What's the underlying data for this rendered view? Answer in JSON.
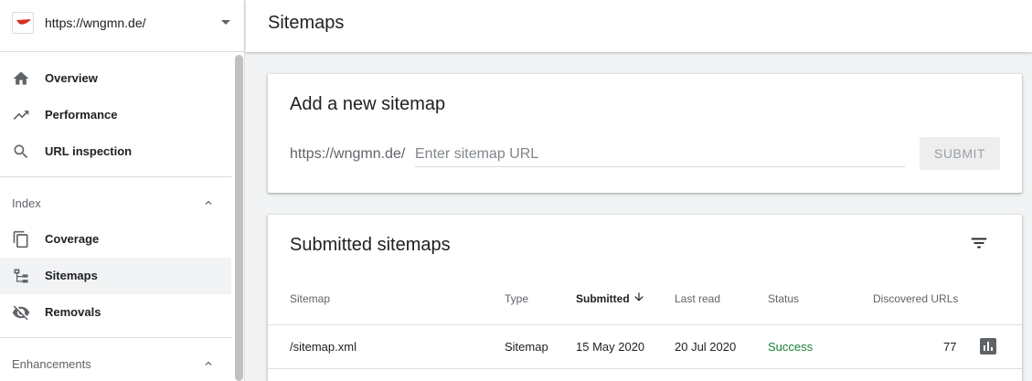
{
  "property": {
    "url": "https://wngmn.de/"
  },
  "nav": {
    "overview": "Overview",
    "performance": "Performance",
    "url_inspection": "URL inspection",
    "index_section": "Index",
    "coverage": "Coverage",
    "sitemaps": "Sitemaps",
    "removals": "Removals",
    "enhancements_section": "Enhancements"
  },
  "header": {
    "title": "Sitemaps"
  },
  "add_card": {
    "title": "Add a new sitemap",
    "prefix": "https://wngmn.de/",
    "placeholder": "Enter sitemap URL",
    "submit_label": "SUBMIT"
  },
  "submitted_card": {
    "title": "Submitted sitemaps",
    "columns": {
      "sitemap": "Sitemap",
      "type": "Type",
      "submitted": "Submitted",
      "last_read": "Last read",
      "status": "Status",
      "discovered": "Discovered URLs"
    },
    "rows": [
      {
        "sitemap": "/sitemap.xml",
        "type": "Sitemap",
        "submitted": "15 May 2020",
        "last_read": "20 Jul 2020",
        "status": "Success",
        "discovered": "77"
      }
    ]
  },
  "colors": {
    "success": "#188038",
    "active_bg": "#f1f3f4",
    "icon": "#5f6368"
  }
}
